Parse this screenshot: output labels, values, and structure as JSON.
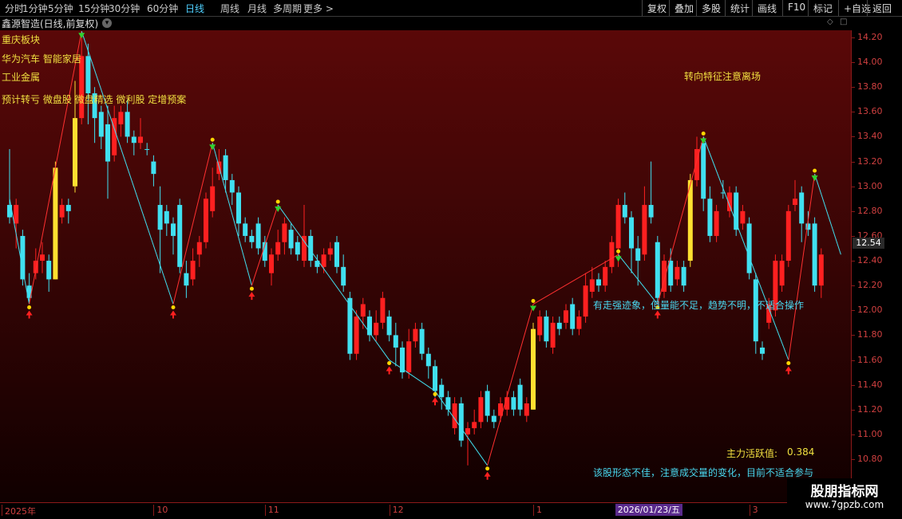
{
  "toolbar": {
    "left_items": [
      "分时",
      "1分钟",
      "5分钟",
      "15分钟",
      "30分钟",
      "60分钟",
      "日线",
      "周线",
      "月线",
      "多周期",
      "更多 >"
    ],
    "active": "日线",
    "right_items": [
      "复权",
      "叠加",
      "多股",
      "统计",
      "画线",
      "F10",
      "标记",
      "+自选",
      "返回"
    ]
  },
  "stock_title": "鑫源智造(日线,前复权)",
  "chart_data": {
    "type": "candlestick",
    "ylim": [
      10.6,
      14.3
    ],
    "y_ticks": [
      10.8,
      11.0,
      11.2,
      11.4,
      11.6,
      11.8,
      12.0,
      12.2,
      12.4,
      12.6,
      12.8,
      13.0,
      13.2,
      13.4,
      13.6,
      13.8,
      14.0,
      14.2
    ],
    "current_price": "12.54",
    "x_labels": [
      "2025年",
      "10",
      "11",
      "12",
      "1",
      "2026/01/23/五",
      "3"
    ],
    "candles": [
      {
        "o": 12.75,
        "c": 12.85,
        "h": 13.3,
        "l": 12.7,
        "k": "c"
      },
      {
        "o": 12.7,
        "c": 12.85,
        "h": 12.9,
        "l": 12.5,
        "k": "r"
      },
      {
        "o": 12.6,
        "c": 12.25,
        "h": 12.65,
        "l": 12.2,
        "k": "c"
      },
      {
        "o": 12.2,
        "c": 12.1,
        "h": 12.3,
        "l": 12.05,
        "k": "c"
      },
      {
        "o": 12.3,
        "c": 12.4,
        "h": 12.5,
        "l": 12.25,
        "k": "r"
      },
      {
        "o": 12.4,
        "c": 12.45,
        "h": 12.55,
        "l": 12.3,
        "k": "r"
      },
      {
        "o": 12.4,
        "c": 12.25,
        "h": 12.45,
        "l": 12.15,
        "k": "c"
      },
      {
        "o": 12.25,
        "c": 13.15,
        "h": 13.2,
        "l": 12.25,
        "k": "y"
      },
      {
        "o": 12.75,
        "c": 12.85,
        "h": 12.9,
        "l": 12.7,
        "k": "r"
      },
      {
        "o": 12.85,
        "c": 12.8,
        "h": 12.9,
        "l": 12.7,
        "k": "c"
      },
      {
        "o": 13.0,
        "c": 13.55,
        "h": 13.85,
        "l": 12.95,
        "k": "y"
      },
      {
        "o": 13.55,
        "c": 14.05,
        "h": 14.25,
        "l": 13.5,
        "k": "r"
      },
      {
        "o": 14.05,
        "c": 13.75,
        "h": 14.15,
        "l": 13.5,
        "k": "c"
      },
      {
        "o": 13.75,
        "c": 13.55,
        "h": 13.8,
        "l": 13.35,
        "k": "c"
      },
      {
        "o": 13.6,
        "c": 13.4,
        "h": 13.65,
        "l": 13.3,
        "k": "c"
      },
      {
        "o": 13.5,
        "c": 13.2,
        "h": 13.65,
        "l": 12.9,
        "k": "c"
      },
      {
        "o": 13.25,
        "c": 13.55,
        "h": 13.65,
        "l": 13.2,
        "k": "r"
      },
      {
        "o": 13.5,
        "c": 13.6,
        "h": 13.65,
        "l": 13.4,
        "k": "r"
      },
      {
        "o": 13.6,
        "c": 13.4,
        "h": 13.7,
        "l": 13.35,
        "k": "c"
      },
      {
        "o": 13.4,
        "c": 13.35,
        "h": 13.45,
        "l": 13.25,
        "k": "c"
      },
      {
        "o": 13.35,
        "c": 13.4,
        "h": 13.55,
        "l": 13.3,
        "k": "r"
      },
      {
        "o": 13.3,
        "c": 13.3,
        "h": 13.35,
        "l": 13.25,
        "k": "c"
      },
      {
        "o": 13.2,
        "c": 13.1,
        "h": 13.25,
        "l": 13.0,
        "k": "c"
      },
      {
        "o": 12.85,
        "c": 12.65,
        "h": 13.0,
        "l": 12.3,
        "k": "c"
      },
      {
        "o": 12.8,
        "c": 12.7,
        "h": 12.85,
        "l": 12.6,
        "k": "c"
      },
      {
        "o": 12.7,
        "c": 12.6,
        "h": 12.75,
        "l": 12.45,
        "k": "c"
      },
      {
        "o": 12.85,
        "c": 12.35,
        "h": 12.9,
        "l": 12.3,
        "k": "c"
      },
      {
        "o": 12.3,
        "c": 12.2,
        "h": 12.4,
        "l": 12.1,
        "k": "c"
      },
      {
        "o": 12.25,
        "c": 12.4,
        "h": 12.5,
        "l": 12.2,
        "k": "r"
      },
      {
        "o": 12.45,
        "c": 12.55,
        "h": 12.6,
        "l": 12.35,
        "k": "r"
      },
      {
        "o": 12.55,
        "c": 12.9,
        "h": 12.95,
        "l": 12.5,
        "k": "r"
      },
      {
        "o": 12.8,
        "c": 13.0,
        "h": 13.15,
        "l": 12.75,
        "k": "r"
      },
      {
        "o": 13.1,
        "c": 13.2,
        "h": 13.3,
        "l": 13.05,
        "k": "r"
      },
      {
        "o": 13.25,
        "c": 13.05,
        "h": 13.3,
        "l": 12.95,
        "k": "c"
      },
      {
        "o": 13.05,
        "c": 12.95,
        "h": 13.1,
        "l": 12.85,
        "k": "c"
      },
      {
        "o": 12.95,
        "c": 12.7,
        "h": 13.0,
        "l": 12.6,
        "k": "c"
      },
      {
        "o": 12.7,
        "c": 12.6,
        "h": 12.75,
        "l": 12.55,
        "k": "c"
      },
      {
        "o": 12.6,
        "c": 12.55,
        "h": 12.65,
        "l": 12.5,
        "k": "c"
      },
      {
        "o": 12.7,
        "c": 12.5,
        "h": 12.75,
        "l": 12.45,
        "k": "c"
      },
      {
        "o": 12.55,
        "c": 12.4,
        "h": 12.6,
        "l": 12.35,
        "k": "c"
      },
      {
        "o": 12.3,
        "c": 12.45,
        "h": 12.5,
        "l": 12.2,
        "k": "r"
      },
      {
        "o": 12.45,
        "c": 12.55,
        "h": 12.65,
        "l": 12.4,
        "k": "r"
      },
      {
        "o": 12.55,
        "c": 12.7,
        "h": 12.75,
        "l": 12.45,
        "k": "r"
      },
      {
        "o": 12.65,
        "c": 12.5,
        "h": 12.7,
        "l": 12.45,
        "k": "c"
      },
      {
        "o": 12.55,
        "c": 12.45,
        "h": 12.6,
        "l": 12.4,
        "k": "c"
      },
      {
        "o": 12.4,
        "c": 12.6,
        "h": 12.85,
        "l": 12.35,
        "k": "r"
      },
      {
        "o": 12.6,
        "c": 12.4,
        "h": 12.65,
        "l": 12.35,
        "k": "c"
      },
      {
        "o": 12.4,
        "c": 12.35,
        "h": 12.45,
        "l": 12.3,
        "k": "c"
      },
      {
        "o": 12.35,
        "c": 12.45,
        "h": 12.5,
        "l": 12.3,
        "k": "r"
      },
      {
        "o": 12.45,
        "c": 12.5,
        "h": 12.55,
        "l": 12.4,
        "k": "r"
      },
      {
        "o": 12.55,
        "c": 12.35,
        "h": 12.6,
        "l": 12.3,
        "k": "c"
      },
      {
        "o": 12.35,
        "c": 12.2,
        "h": 12.45,
        "l": 12.15,
        "k": "c"
      },
      {
        "o": 12.1,
        "c": 11.65,
        "h": 12.15,
        "l": 11.6,
        "k": "c"
      },
      {
        "o": 11.65,
        "c": 11.95,
        "h": 12.0,
        "l": 11.6,
        "k": "r"
      },
      {
        "o": 11.95,
        "c": 12.05,
        "h": 12.1,
        "l": 11.85,
        "k": "r"
      },
      {
        "o": 11.95,
        "c": 11.8,
        "h": 12.0,
        "l": 11.75,
        "k": "c"
      },
      {
        "o": 11.8,
        "c": 11.9,
        "h": 12.0,
        "l": 11.75,
        "k": "r"
      },
      {
        "o": 11.9,
        "c": 12.1,
        "h": 12.15,
        "l": 11.85,
        "k": "r"
      },
      {
        "o": 11.95,
        "c": 11.8,
        "h": 12.0,
        "l": 11.75,
        "k": "c"
      },
      {
        "o": 11.8,
        "c": 11.7,
        "h": 11.9,
        "l": 11.55,
        "k": "c"
      },
      {
        "o": 11.7,
        "c": 11.5,
        "h": 11.75,
        "l": 11.45,
        "k": "c"
      },
      {
        "o": 11.5,
        "c": 11.75,
        "h": 11.85,
        "l": 11.45,
        "k": "r"
      },
      {
        "o": 11.75,
        "c": 11.85,
        "h": 11.9,
        "l": 11.7,
        "k": "r"
      },
      {
        "o": 11.85,
        "c": 11.65,
        "h": 11.9,
        "l": 11.6,
        "k": "c"
      },
      {
        "o": 11.65,
        "c": 11.55,
        "h": 11.7,
        "l": 11.45,
        "k": "c"
      },
      {
        "o": 11.55,
        "c": 11.35,
        "h": 11.6,
        "l": 11.3,
        "k": "c"
      },
      {
        "o": 11.4,
        "c": 11.3,
        "h": 11.45,
        "l": 11.2,
        "k": "c"
      },
      {
        "o": 11.3,
        "c": 11.2,
        "h": 11.35,
        "l": 11.15,
        "k": "c"
      },
      {
        "o": 11.05,
        "c": 11.25,
        "h": 11.3,
        "l": 11.0,
        "k": "r"
      },
      {
        "o": 11.25,
        "c": 10.95,
        "h": 11.3,
        "l": 10.9,
        "k": "c"
      },
      {
        "o": 11.0,
        "c": 11.05,
        "h": 11.1,
        "l": 10.75,
        "k": "r"
      },
      {
        "o": 11.05,
        "c": 11.1,
        "h": 11.2,
        "l": 11.0,
        "k": "r"
      },
      {
        "o": 11.1,
        "c": 11.3,
        "h": 11.35,
        "l": 11.05,
        "k": "r"
      },
      {
        "o": 11.35,
        "c": 11.15,
        "h": 11.4,
        "l": 11.1,
        "k": "c"
      },
      {
        "o": 11.15,
        "c": 11.1,
        "h": 11.2,
        "l": 11.05,
        "k": "c"
      },
      {
        "o": 11.15,
        "c": 11.25,
        "h": 11.3,
        "l": 11.1,
        "k": "r"
      },
      {
        "o": 11.2,
        "c": 11.3,
        "h": 11.35,
        "l": 11.15,
        "k": "r"
      },
      {
        "o": 11.3,
        "c": 11.2,
        "h": 11.35,
        "l": 11.15,
        "k": "c"
      },
      {
        "o": 11.4,
        "c": 11.2,
        "h": 11.45,
        "l": 11.15,
        "k": "c"
      },
      {
        "o": 11.15,
        "c": 11.25,
        "h": 11.3,
        "l": 11.1,
        "k": "r"
      },
      {
        "o": 11.2,
        "c": 11.85,
        "h": 11.9,
        "l": 11.2,
        "k": "y"
      },
      {
        "o": 11.8,
        "c": 11.95,
        "h": 12.0,
        "l": 11.75,
        "k": "r"
      },
      {
        "o": 11.95,
        "c": 11.75,
        "h": 12.0,
        "l": 11.7,
        "k": "c"
      },
      {
        "o": 11.7,
        "c": 11.9,
        "h": 11.95,
        "l": 11.65,
        "k": "r"
      },
      {
        "o": 11.9,
        "c": 11.85,
        "h": 11.95,
        "l": 11.8,
        "k": "c"
      },
      {
        "o": 11.9,
        "c": 12.0,
        "h": 12.05,
        "l": 11.85,
        "k": "r"
      },
      {
        "o": 12.05,
        "c": 11.85,
        "h": 12.1,
        "l": 11.8,
        "k": "c"
      },
      {
        "o": 11.85,
        "c": 11.95,
        "h": 12.0,
        "l": 11.8,
        "k": "r"
      },
      {
        "o": 11.95,
        "c": 12.2,
        "h": 12.3,
        "l": 11.9,
        "k": "r"
      },
      {
        "o": 12.15,
        "c": 12.25,
        "h": 12.35,
        "l": 12.1,
        "k": "r"
      },
      {
        "o": 12.25,
        "c": 12.2,
        "h": 12.3,
        "l": 12.15,
        "k": "c"
      },
      {
        "o": 12.2,
        "c": 12.35,
        "h": 12.4,
        "l": 12.15,
        "k": "r"
      },
      {
        "o": 12.35,
        "c": 12.55,
        "h": 12.6,
        "l": 12.3,
        "k": "r"
      },
      {
        "o": 12.5,
        "c": 12.85,
        "h": 12.9,
        "l": 12.35,
        "k": "r"
      },
      {
        "o": 12.85,
        "c": 12.75,
        "h": 12.95,
        "l": 12.7,
        "k": "c"
      },
      {
        "o": 12.75,
        "c": 12.5,
        "h": 12.8,
        "l": 12.3,
        "k": "c"
      },
      {
        "o": 12.5,
        "c": 12.4,
        "h": 12.6,
        "l": 12.2,
        "k": "c"
      },
      {
        "o": 12.45,
        "c": 12.85,
        "h": 13.0,
        "l": 12.4,
        "k": "r"
      },
      {
        "o": 12.85,
        "c": 12.75,
        "h": 13.2,
        "l": 12.7,
        "k": "c"
      },
      {
        "o": 12.55,
        "c": 12.1,
        "h": 12.6,
        "l": 12.05,
        "k": "c"
      },
      {
        "o": 12.15,
        "c": 12.4,
        "h": 12.45,
        "l": 12.1,
        "k": "r"
      },
      {
        "o": 12.4,
        "c": 12.2,
        "h": 12.5,
        "l": 12.15,
        "k": "c"
      },
      {
        "o": 12.25,
        "c": 12.35,
        "h": 12.4,
        "l": 12.2,
        "k": "r"
      },
      {
        "o": 12.35,
        "c": 12.2,
        "h": 12.4,
        "l": 12.15,
        "k": "c"
      },
      {
        "o": 12.4,
        "c": 13.05,
        "h": 13.1,
        "l": 12.35,
        "k": "y"
      },
      {
        "o": 13.05,
        "c": 13.3,
        "h": 13.4,
        "l": 13.0,
        "k": "r"
      },
      {
        "o": 13.35,
        "c": 12.9,
        "h": 13.4,
        "l": 12.8,
        "k": "c"
      },
      {
        "o": 12.9,
        "c": 12.6,
        "h": 13.0,
        "l": 12.55,
        "k": "c"
      },
      {
        "o": 12.6,
        "c": 12.8,
        "h": 12.85,
        "l": 12.55,
        "k": "r"
      },
      {
        "o": 12.95,
        "c": 12.95,
        "h": 13.05,
        "l": 12.9,
        "k": "c"
      },
      {
        "o": 12.8,
        "c": 12.95,
        "h": 13.0,
        "l": 12.75,
        "k": "r"
      },
      {
        "o": 12.95,
        "c": 12.65,
        "h": 13.0,
        "l": 12.6,
        "k": "c"
      },
      {
        "o": 12.7,
        "c": 12.8,
        "h": 12.85,
        "l": 12.65,
        "k": "r"
      },
      {
        "o": 12.7,
        "c": 12.3,
        "h": 12.75,
        "l": 12.25,
        "k": "c"
      },
      {
        "o": 12.25,
        "c": 11.75,
        "h": 12.3,
        "l": 11.65,
        "k": "c"
      },
      {
        "o": 11.7,
        "c": 11.65,
        "h": 11.75,
        "l": 11.6,
        "k": "c"
      },
      {
        "o": 11.9,
        "c": 12.05,
        "h": 12.1,
        "l": 11.85,
        "k": "r"
      },
      {
        "o": 12.0,
        "c": 12.4,
        "h": 12.45,
        "l": 11.95,
        "k": "r"
      },
      {
        "o": 12.2,
        "c": 12.4,
        "h": 12.45,
        "l": 12.15,
        "k": "r"
      },
      {
        "o": 12.4,
        "c": 12.8,
        "h": 12.85,
        "l": 12.35,
        "k": "r"
      },
      {
        "o": 12.85,
        "c": 12.9,
        "h": 13.05,
        "l": 12.8,
        "k": "r"
      },
      {
        "o": 12.95,
        "c": 12.7,
        "h": 13.0,
        "l": 12.55,
        "k": "c"
      },
      {
        "o": 12.7,
        "c": 12.65,
        "h": 12.8,
        "l": 12.6,
        "k": "c"
      },
      {
        "o": 12.7,
        "c": 12.2,
        "h": 12.75,
        "l": 12.15,
        "k": "c"
      },
      {
        "o": 12.2,
        "c": 12.45,
        "h": 12.5,
        "l": 12.1,
        "k": "r"
      }
    ],
    "zigzag_points": [
      {
        "i": 0,
        "p": 12.9,
        "t": "start"
      },
      {
        "i": 3,
        "p": 12.05,
        "t": "low"
      },
      {
        "i": 11,
        "p": 14.25,
        "t": "high"
      },
      {
        "i": 25,
        "p": 12.05,
        "t": "low"
      },
      {
        "i": 31,
        "p": 13.35,
        "t": "high"
      },
      {
        "i": 37,
        "p": 12.2,
        "t": "low"
      },
      {
        "i": 41,
        "p": 12.85,
        "t": "high"
      },
      {
        "i": 58,
        "p": 11.6,
        "t": "low"
      },
      {
        "i": 65,
        "p": 11.35,
        "t": "low"
      },
      {
        "i": 73,
        "p": 10.75,
        "t": "low"
      },
      {
        "i": 80,
        "p": 12.05,
        "t": "high"
      },
      {
        "i": 93,
        "p": 12.45,
        "t": "high"
      },
      {
        "i": 99,
        "p": 12.05,
        "t": "low"
      },
      {
        "i": 106,
        "p": 13.4,
        "t": "high"
      },
      {
        "i": 119,
        "p": 11.6,
        "t": "low"
      },
      {
        "i": 123,
        "p": 13.1,
        "t": "high"
      },
      {
        "i": 127,
        "p": 12.45,
        "t": "end"
      }
    ],
    "colors": {
      "up": "#ff2020",
      "down": "#40e0f0",
      "strong": "#ffe030",
      "zigzag_up": "#ff3030",
      "zigzag_down": "#40e0f0",
      "marker": "#ffd700"
    }
  },
  "sector_labels": {
    "line1": "重庆板块",
    "line2": "华为汽车  智能家居",
    "line3": "工业金属",
    "line4": "预计转亏  微盘股  微盘精选  微利股  定增预案"
  },
  "annotations": {
    "turn_signal": "转向特征注意离场",
    "mid_text": "有走强迹象，但量能不足，趋势不明，不适合操作",
    "activity_label": "主力活跃值:",
    "activity_value": "0.384",
    "bottom_text": "该股形态不佳，注意成交量的变化，目前不适合参与"
  },
  "watermark": {
    "title": "股朋指标网",
    "url": "www.7gpzb.com"
  }
}
